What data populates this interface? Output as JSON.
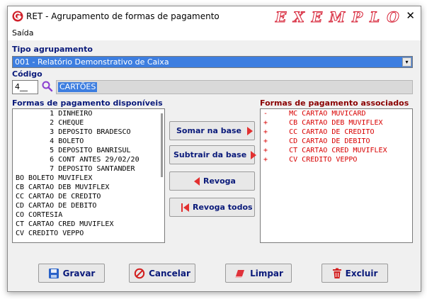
{
  "window": {
    "title": "RET - Agrupamento de formas de pagamento",
    "watermark": "EXEMPLO",
    "close_glyph": "✕",
    "app_icon": "app-logo-icon"
  },
  "menu": {
    "items": [
      "Saída"
    ]
  },
  "tipo": {
    "label": "Tipo agrupamento",
    "selected": "001 - Relatório Demonstrativo de Caixa",
    "arrow_glyph": "▾"
  },
  "codigo": {
    "label": "Código",
    "value": "4__",
    "description": "CARTÕES"
  },
  "available": {
    "label": "Formas de pagamento disponíveis",
    "items": [
      "        1 DINHEIRO",
      "        2 CHEQUE",
      "        3 DEPOSITO BRADESCO",
      "        4 BOLETO",
      "        5 DEPOSITO BANRISUL",
      "        6 CONT ANTES 29/02/20",
      "        7 DEPOSITO SANTANDER",
      "BO BOLETO MUVIFLEX",
      "CB CARTAO DEB MUVIFLEX",
      "CC CARTAO DE CREDITO",
      "CD CARTAO DE DEBITO",
      "CO CORTESIA",
      "CT CARTAO CRED MUVIFLEX",
      "CV CREDITO VEPPO"
    ]
  },
  "associated": {
    "label": "Formas de pagamento associados",
    "items": [
      "-     MC CARTAO MUVICARD",
      "+     CB CARTAO DEB MUVIFLEX",
      "+     CC CARTAO DE CREDITO",
      "+     CD CARTAO DE DEBITO",
      "+     CT CARTAO CRED MUVIFLEX",
      "+     CV CREDITO VEPPO"
    ]
  },
  "actions": {
    "somar": "Somar  na base",
    "subtrair": "Subtrair da base",
    "revoga": "Revoga",
    "revoga_todos": "Revoga todos"
  },
  "footer": {
    "gravar": "Gravar",
    "cancelar": "Cancelar",
    "limpar": "Limpar",
    "excluir": "Excluir"
  },
  "colors": {
    "accent_blue": "#3d7ee0",
    "label_navy": "#0a1a7a",
    "label_maroon": "#8a0000",
    "associated_red": "#d80000",
    "watermark_red": "#d7263a"
  }
}
